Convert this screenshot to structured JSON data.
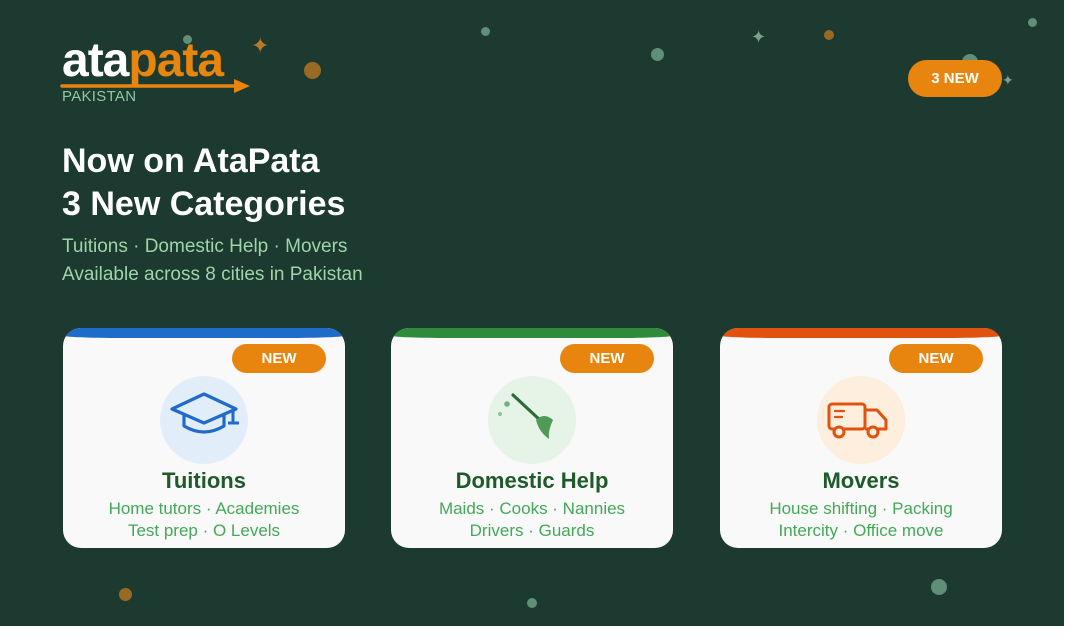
{
  "brand": {
    "logo_part1": "ata",
    "logo_part2": "pata",
    "country": "PAKISTAN",
    "accent_color": "#e8850e",
    "background_color": "#1c3a2f"
  },
  "header": {
    "badge_label": "3 NEW"
  },
  "hero": {
    "headline_line1": "Now on AtaPata",
    "headline_line2": "3 New Categories",
    "categories_line": "Tuitions · Domestic Help · Movers",
    "availability_line": "Available across 8 cities in Pakistan"
  },
  "cards": [
    {
      "badge": "NEW",
      "title": "Tuitions",
      "line1": "Home tutors · Academies",
      "line2": "Test prep · O Levels",
      "icon": "graduation-cap-icon",
      "accent": "#1f6bc9"
    },
    {
      "badge": "NEW",
      "title": "Domestic Help",
      "line1": "Maids · Cooks · Nannies",
      "line2": "Drivers · Guards",
      "icon": "broom-icon",
      "accent": "#2e8b3a"
    },
    {
      "badge": "NEW",
      "title": "Movers",
      "line1": "House shifting · Packing",
      "line2": "Intercity · Office move",
      "icon": "moving-truck-icon",
      "accent": "#e0520e"
    }
  ]
}
